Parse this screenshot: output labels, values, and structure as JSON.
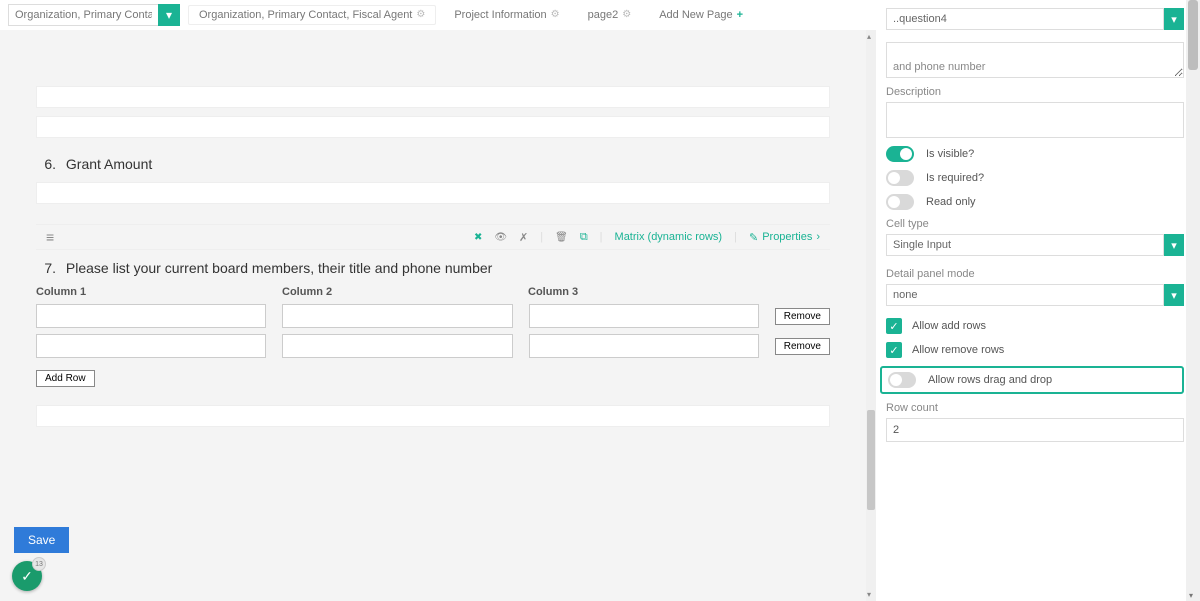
{
  "topbar": {
    "page_selector_value": "Organization, Primary Contac",
    "tabs": [
      {
        "label": "Organization, Primary Contact, Fiscal Agent",
        "active": true
      },
      {
        "label": "Project Information",
        "active": false
      },
      {
        "label": "page2",
        "active": false
      }
    ],
    "add_page_label": "Add New Page"
  },
  "questions": {
    "q6_num": "6.",
    "q6_title": "Grant Amount",
    "q7_num": "7.",
    "q7_title": "Please list your current board members, their title and phone number"
  },
  "matrix_toolbar": {
    "type_label": "Matrix (dynamic rows)",
    "properties_label": "Properties"
  },
  "matrix": {
    "cols": [
      "Column 1",
      "Column 2",
      "Column 3"
    ],
    "remove_label": "Remove",
    "add_row_label": "Add Row"
  },
  "side": {
    "selector_value": "..question4",
    "title_value": "and phone number",
    "desc_label": "Description",
    "toggles": {
      "visible": "Is visible?",
      "required": "Is required?",
      "readonly": "Read only"
    },
    "cell_type_label": "Cell type",
    "cell_type_value": "Single Input",
    "detail_mode_label": "Detail panel mode",
    "detail_mode_value": "none",
    "allow_add": "Allow add rows",
    "allow_remove": "Allow remove rows",
    "allow_drag": "Allow rows drag and drop",
    "row_count_label": "Row count",
    "row_count_value": "2"
  },
  "footer": {
    "save": "Save",
    "fab_badge": "13"
  },
  "symbols": {
    "caret": "▾",
    "chevron_right": "›",
    "gear": "⚙",
    "plus": "+",
    "hamburger": "≡",
    "check": "✓",
    "close_circle": "✖",
    "eye": "👁",
    "strike": "✗",
    "trash": "🗑",
    "copy": "⧉",
    "wand": "✎"
  }
}
